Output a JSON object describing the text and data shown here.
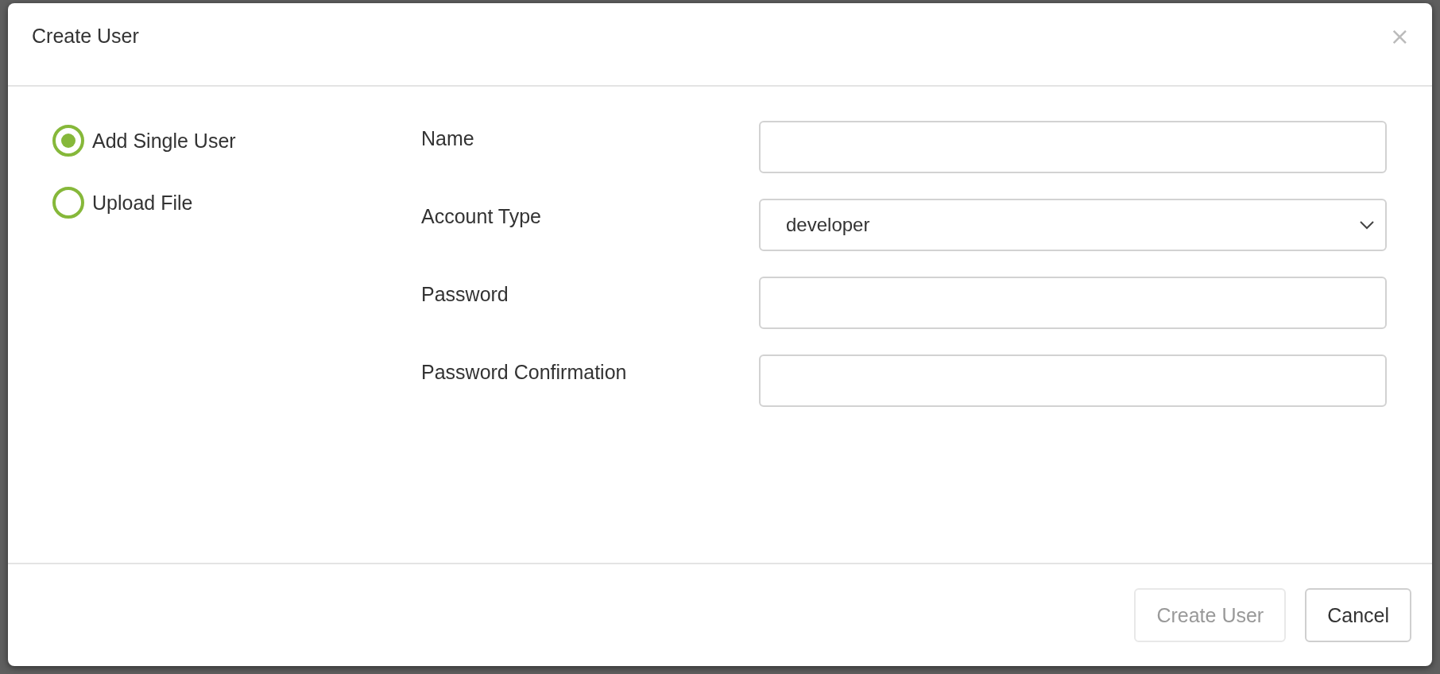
{
  "dialog": {
    "title": "Create User",
    "close": "×"
  },
  "modes": [
    {
      "label": "Add Single User",
      "selected": true
    },
    {
      "label": "Upload File",
      "selected": false
    }
  ],
  "fields": [
    {
      "label": "Name",
      "kind": "text"
    },
    {
      "label": "Account Type",
      "kind": "select",
      "value": "developer"
    },
    {
      "label": "Password",
      "kind": "password"
    },
    {
      "label": "Password Confirmation",
      "kind": "password"
    }
  ],
  "buttons": [
    {
      "label": "Create User",
      "disabled": true
    },
    {
      "label": "Cancel",
      "disabled": false
    }
  ]
}
